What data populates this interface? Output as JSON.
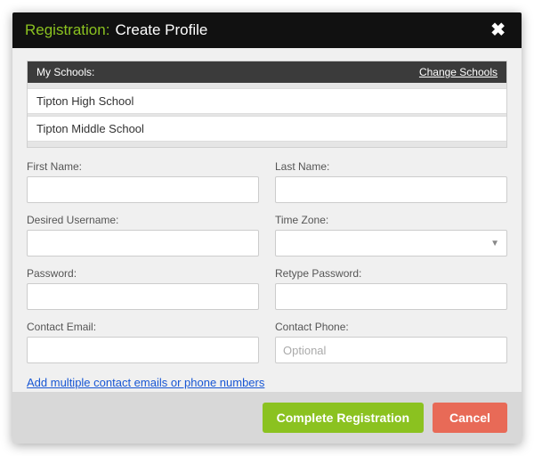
{
  "header": {
    "prefix": "Registration:",
    "title": "Create Profile",
    "close_glyph": "✖"
  },
  "schools": {
    "label": "My Schools:",
    "change_label": "Change Schools",
    "items": [
      "Tipton High School",
      "Tipton Middle School"
    ]
  },
  "fields": {
    "first_name": {
      "label": "First Name:",
      "value": ""
    },
    "last_name": {
      "label": "Last Name:",
      "value": ""
    },
    "username": {
      "label": "Desired Username:",
      "value": ""
    },
    "timezone": {
      "label": "Time Zone:",
      "value": ""
    },
    "password": {
      "label": "Password:",
      "value": ""
    },
    "password2": {
      "label": "Retype Password:",
      "value": ""
    },
    "contact_email": {
      "label": "Contact Email:",
      "value": ""
    },
    "contact_phone": {
      "label": "Contact Phone:",
      "value": "",
      "placeholder": "Optional"
    }
  },
  "links": {
    "multi_contact": "Add multiple contact emails or phone numbers"
  },
  "footer": {
    "submit": "Complete Registration",
    "cancel": "Cancel"
  }
}
